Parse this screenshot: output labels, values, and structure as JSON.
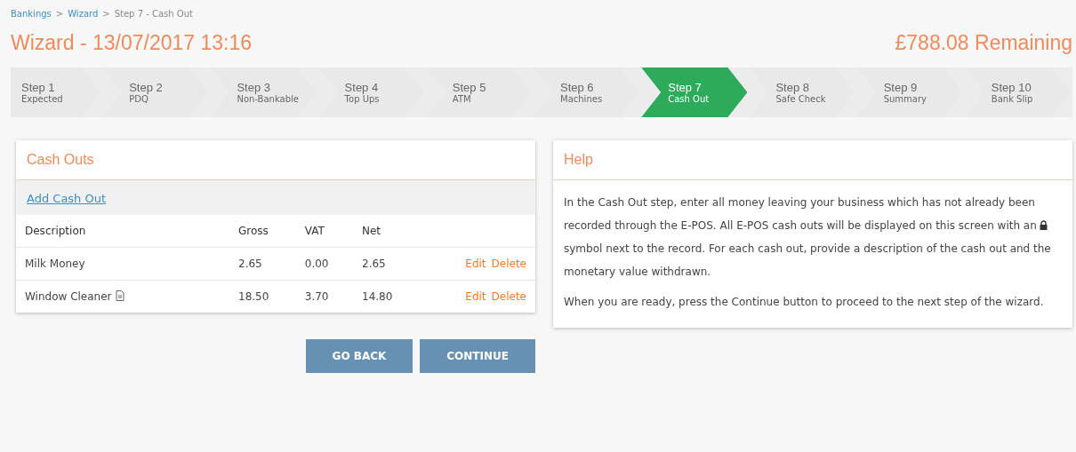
{
  "breadcrumb": [
    {
      "text": "Bankings",
      "kind": "link"
    },
    {
      "text": ">",
      "kind": "separator"
    },
    {
      "text": "Wizard",
      "kind": "link"
    },
    {
      "text": ">",
      "kind": "separator"
    },
    {
      "text": "Step 7 - Cash Out",
      "kind": "current"
    }
  ],
  "title": "Wizard - 13/07/2017 13:16",
  "remaining": "£788.08 Remaining",
  "steps": [
    {
      "label": "Step 1",
      "caption": "Expected",
      "selected": false
    },
    {
      "label": "Step 2",
      "caption": "PDQ",
      "selected": false
    },
    {
      "label": "Step 3",
      "caption": "Non-Bankable",
      "selected": false
    },
    {
      "label": "Step 4",
      "caption": "Top Ups",
      "selected": false
    },
    {
      "label": "Step 5",
      "caption": "ATM",
      "selected": false
    },
    {
      "label": "Step 6",
      "caption": "Machines",
      "selected": false
    },
    {
      "label": "Step 7",
      "caption": "Cash Out",
      "selected": true
    },
    {
      "label": "Step 8",
      "caption": "Safe Check",
      "selected": false
    },
    {
      "label": "Step 9",
      "caption": "Summary",
      "selected": false
    },
    {
      "label": "Step 10",
      "caption": "Bank Slip",
      "selected": false
    }
  ],
  "cash_outs": {
    "title": "Cash Outs",
    "add_link": "Add Cash Out",
    "columns": [
      "Description",
      "Gross",
      "VAT",
      "Net"
    ],
    "rows": [
      {
        "description": "Milk Money",
        "has_document": false,
        "gross": "2.65",
        "vat": "0.00",
        "net": "2.65",
        "edit": "Edit",
        "delete": "Delete"
      },
      {
        "description": "Window Cleaner",
        "has_document": true,
        "gross": "18.50",
        "vat": "3.70",
        "net": "14.80",
        "edit": "Edit",
        "delete": "Delete"
      }
    ]
  },
  "buttons": [
    "GO BACK",
    "CONTINUE"
  ],
  "help": {
    "title": "Help",
    "paragraph_1": {
      "before_icon": "In the Cash Out step, enter all money leaving your business which has not already been recorded through the E-POS. All E-POS cash outs will be displayed on this screen with an",
      "after_icon": "symbol next to the record. For each cash out, provide a description of the cash out and the monetary value withdrawn."
    },
    "paragraph_2": "When you are ready, press the Continue button to proceed to the next step of the wizard."
  }
}
